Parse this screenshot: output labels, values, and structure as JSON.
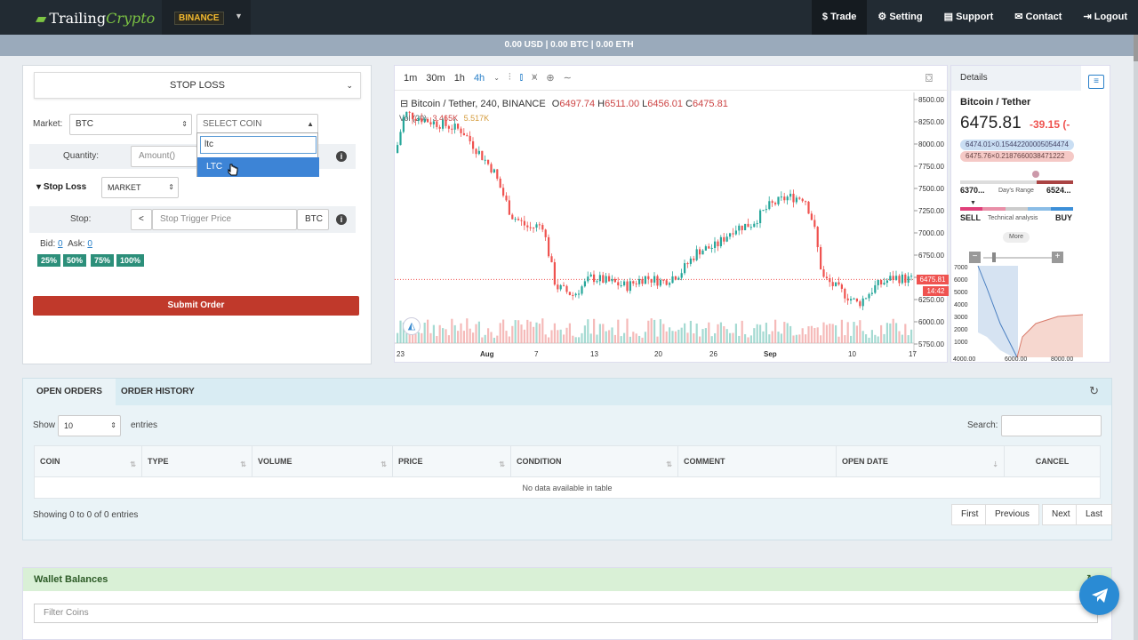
{
  "brand": {
    "prefix": "Trailing",
    "suffix": "Crypto"
  },
  "exchange": {
    "label": "BINANCE"
  },
  "nav": [
    {
      "label": "$ Trade"
    },
    {
      "label": "⚙ Setting"
    },
    {
      "label": "▤ Support"
    },
    {
      "label": "✉ Contact"
    },
    {
      "label": "⇥ Logout"
    }
  ],
  "balance_bar": "0.00 USD  |  0.00 BTC  |  0.00 ETH",
  "order_form": {
    "order_type": "STOP LOSS",
    "market_label": "Market:",
    "market_value": "BTC",
    "coin_placeholder": "SELECT COIN",
    "coin_search": "ltc",
    "coin_option": "LTC",
    "quantity_label": "Quantity:",
    "quantity_placeholder": "Amount()",
    "stoploss_label": "Stop Loss",
    "stoploss_type": "MARKET",
    "stop_label": "Stop:",
    "stop_operator": "<",
    "stop_placeholder": "Stop Trigger Price",
    "stop_unit": "BTC",
    "bid_label": "Bid:",
    "bid_value": "0",
    "ask_label": "Ask:",
    "ask_value": "0",
    "pct_buttons": [
      "25%",
      "50%",
      "75%",
      "100%"
    ],
    "submit_label": "Submit Order"
  },
  "chart": {
    "intervals": [
      "1m",
      "30m",
      "1h",
      "4h"
    ],
    "active_interval": "4h",
    "title": "Bitcoin / Tether, 240, BINANCE",
    "ohlc": {
      "o_label": "O",
      "o": "6497.74",
      "h_label": "H",
      "h": "6511.00",
      "l_label": "L",
      "l": "6456.01",
      "c_label": "C",
      "c": "6475.81"
    },
    "vol_label": "Vol (20)",
    "vol_values": [
      "3.465K",
      "5.517K"
    ],
    "price_tag": "6475.81",
    "time_tag": "14:42",
    "y_ticks": [
      "8500.00",
      "8250.00",
      "8000.00",
      "7750.00",
      "7500.00",
      "7250.00",
      "7000.00",
      "6750.00",
      "6500.00",
      "6250.00",
      "6000.00",
      "5750.00"
    ],
    "x_ticks": [
      "23",
      "Aug",
      "7",
      "13",
      "20",
      "26",
      "Sep",
      "10",
      "17"
    ]
  },
  "details": {
    "heading": "Details",
    "pair": "Bitcoin / Tether",
    "price_main": "6475.81",
    "price_change": "-39.15 (-",
    "bid_line": "6474.01×0.15442200005054474",
    "ask_line": "6475.76×0.2187660038471222",
    "range_low": "6370...",
    "range_label": "Day's Range",
    "range_high": "6524...",
    "sell": "SELL",
    "tech": "Technical analysis",
    "buy": "BUY",
    "more": "More",
    "depth_y": [
      "7000",
      "6000",
      "5000",
      "4000",
      "3000",
      "2000",
      "1000"
    ],
    "depth_x": [
      "4000.00",
      "6000.00",
      "8000.00"
    ]
  },
  "orders": {
    "tabs": [
      "OPEN ORDERS",
      "ORDER HISTORY"
    ],
    "show_label": "Show",
    "show_value": "10",
    "entries_label": "entries",
    "search_label": "Search:",
    "columns": [
      "COIN",
      "TYPE",
      "VOLUME",
      "PRICE",
      "CONDITION",
      "COMMENT",
      "OPEN DATE",
      "CANCEL"
    ],
    "empty": "No data available in table",
    "info": "Showing 0 to 0 of 0 entries",
    "pager": [
      "First",
      "Previous",
      "Next",
      "Last"
    ]
  },
  "wallet": {
    "title": "Wallet Balances",
    "filter_placeholder": "Filter Coins"
  },
  "colors": {
    "accent": "#2a80c9",
    "submit": "#c0392b",
    "up": "#26a69a",
    "down": "#ef5350"
  }
}
